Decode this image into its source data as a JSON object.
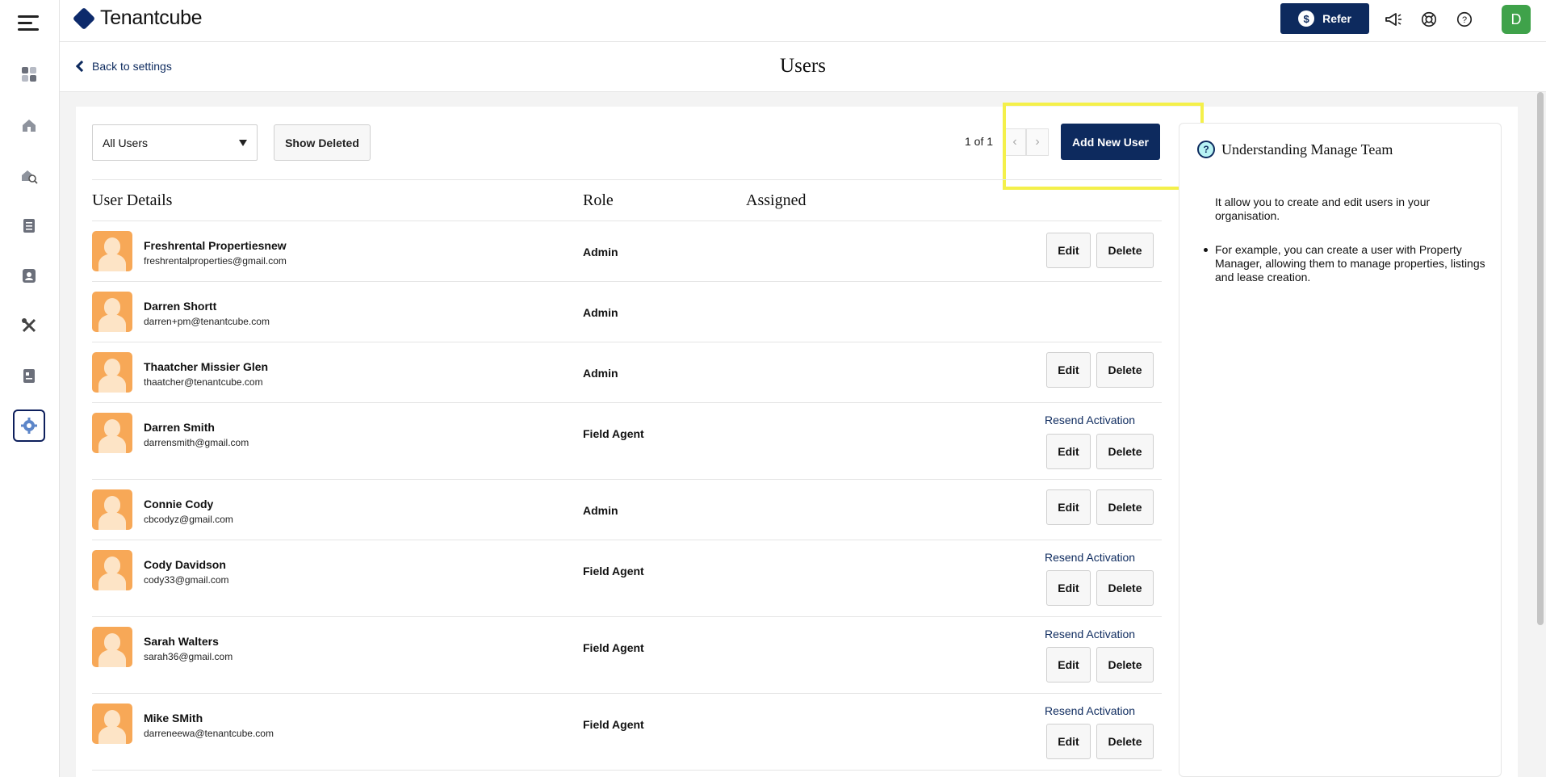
{
  "brand": {
    "name": "Tenantcube",
    "accent": "#0d2a5e"
  },
  "header": {
    "refer_label": "Refer",
    "refer_symbol": "$",
    "avatar_initial": "D",
    "avatar_color": "#3fa24a",
    "icons": [
      "megaphone-icon",
      "lifebuoy-icon",
      "help-icon"
    ]
  },
  "rail": {
    "items": [
      "dashboard-icon",
      "home-icon",
      "property-search-icon",
      "clipboard-icon",
      "contacts-icon",
      "tools-icon",
      "id-card-icon",
      "settings-icon"
    ],
    "active": "settings-icon"
  },
  "subheader": {
    "back_label": "Back to settings",
    "title": "Users"
  },
  "toolbar": {
    "filter_value": "All Users",
    "show_deleted_label": "Show Deleted",
    "pager_text": "1 of 1",
    "add_user_label": "Add New User"
  },
  "table": {
    "columns": {
      "details": "User Details",
      "role": "Role",
      "assigned": "Assigned"
    },
    "edit_label": "Edit",
    "delete_label": "Delete",
    "resend_label": "Resend Activation",
    "rows": [
      {
        "name": "Freshrental Propertiesnew",
        "email": "freshrentalproperties@gmail.com",
        "role": "Admin"
      },
      {
        "name": "Darren Shortt",
        "email": "darren+pm@tenantcube.com",
        "role": "Admin"
      },
      {
        "name": "Thaatcher Missier Glen",
        "email": "thaatcher@tenantcube.com",
        "role": "Admin"
      },
      {
        "name": "Darren Smith",
        "email": "darrensmith@gmail.com",
        "role": "Field Agent"
      },
      {
        "name": "Connie Cody",
        "email": "cbcodyz@gmail.com",
        "role": "Admin"
      },
      {
        "name": "Cody Davidson",
        "email": "cody33@gmail.com",
        "role": "Field Agent"
      },
      {
        "name": "Sarah Walters",
        "email": "sarah36@gmail.com",
        "role": "Field Agent"
      },
      {
        "name": "Mike SMith",
        "email": "darreneewa@tenantcube.com",
        "role": "Field Agent"
      }
    ]
  },
  "help_panel": {
    "title": "Understanding Manage Team",
    "intro": "It allow you to create and edit users in your organisation.",
    "bullet": "For example, you can create a user with Property Manager, allowing them to manage properties, listings and lease creation."
  }
}
